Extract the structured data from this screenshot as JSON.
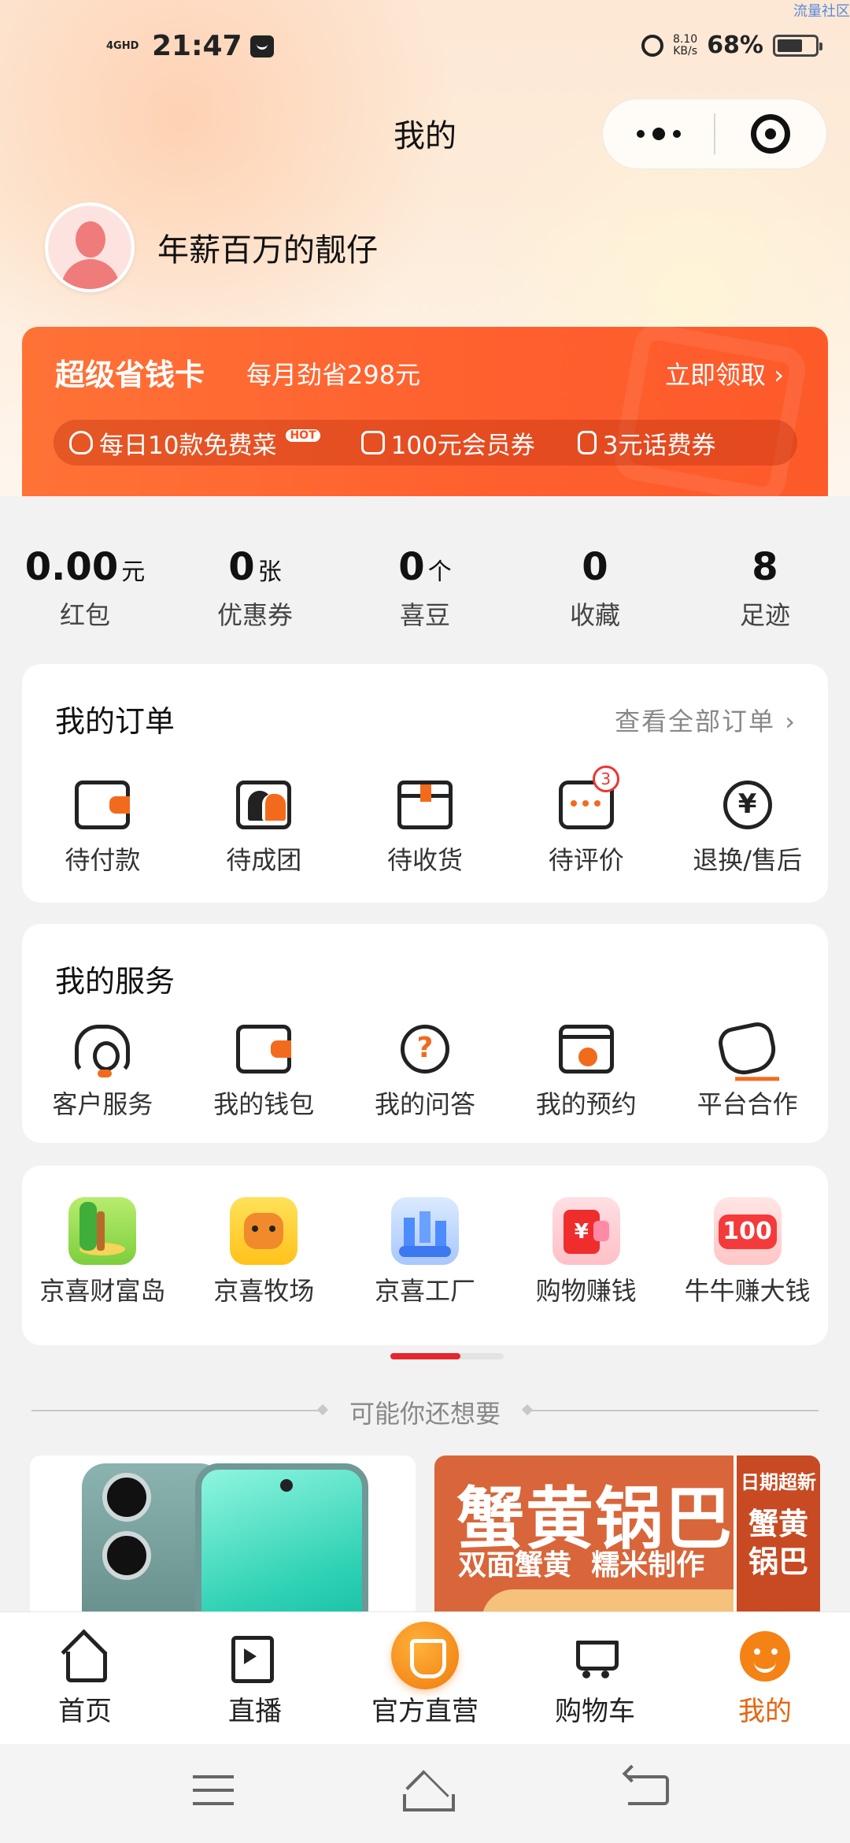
{
  "watermark": "流量社区",
  "status_bar": {
    "network": "4GHD",
    "time": "21:47",
    "speed": "8.10\nKB/s",
    "battery": "68%",
    "battery_level": 0.68
  },
  "header": {
    "title": "我的"
  },
  "user": {
    "name": "年薪百万的靓仔"
  },
  "save_card": {
    "title": "超级省钱卡",
    "subtitle": "每月劲省298元",
    "link": "立即领取",
    "perks": [
      {
        "icon": "vegetable-icon",
        "label": "每日10款免费菜",
        "badge": "HOT"
      },
      {
        "icon": "coupon-icon",
        "label": "100元会员券"
      },
      {
        "icon": "phone-bill-icon",
        "label": "3元话费券"
      }
    ]
  },
  "stats": [
    {
      "value": "0.00",
      "unit": "元",
      "label": "红包"
    },
    {
      "value": "0",
      "unit": "张",
      "label": "优惠券"
    },
    {
      "value": "0",
      "unit": "个",
      "label": "喜豆"
    },
    {
      "value": "0",
      "unit": "",
      "label": "收藏"
    },
    {
      "value": "8",
      "unit": "",
      "label": "足迹"
    }
  ],
  "orders": {
    "title": "我的订单",
    "view_all": "查看全部订单",
    "items": [
      {
        "icon": "wallet-icon",
        "label": "待付款"
      },
      {
        "icon": "group-buy-icon",
        "label": "待成团"
      },
      {
        "icon": "package-icon",
        "label": "待收货"
      },
      {
        "icon": "comment-icon",
        "label": "待评价",
        "badge": "3"
      },
      {
        "icon": "refund-icon",
        "label": "退换/售后"
      }
    ]
  },
  "services": {
    "title": "我的服务",
    "items": [
      {
        "icon": "headset-icon",
        "label": "客户服务"
      },
      {
        "icon": "wallet-icon",
        "label": "我的钱包"
      },
      {
        "icon": "question-icon",
        "label": "我的问答"
      },
      {
        "icon": "calendar-icon",
        "label": "我的预约"
      },
      {
        "icon": "handshake-icon",
        "label": "平台合作"
      }
    ]
  },
  "games": {
    "items": [
      {
        "icon": "island-icon",
        "label": "京喜财富岛"
      },
      {
        "icon": "farm-icon",
        "label": "京喜牧场"
      },
      {
        "icon": "factory-icon",
        "label": "京喜工厂"
      },
      {
        "icon": "red-packet-icon",
        "label": "购物赚钱"
      },
      {
        "icon": "cow-money-icon",
        "label": "牛牛赚大钱",
        "icon_text": "100"
      }
    ],
    "scroll_progress": 0.62
  },
  "recommend": {
    "title": "可能你还想要",
    "products": [
      {
        "name": "phone-product"
      },
      {
        "title": "蟹黄锅巴",
        "subtitle": "双面蟹黄  糯米制作",
        "side_top": "日期超新",
        "side_main": "蟹黄锅巴"
      }
    ]
  },
  "tabbar": [
    {
      "icon": "home-icon",
      "label": "首页",
      "active": false
    },
    {
      "icon": "live-icon",
      "label": "直播",
      "active": false
    },
    {
      "icon": "official-store-icon",
      "label": "官方直营",
      "active": false
    },
    {
      "icon": "cart-icon",
      "label": "购物车",
      "active": false
    },
    {
      "icon": "me-icon",
      "label": "我的",
      "active": true
    }
  ],
  "colors": {
    "accent": "#f26b1d",
    "save_card": "#ff5f2e",
    "active_tab": "#e7640e",
    "badge": "#e33333"
  }
}
